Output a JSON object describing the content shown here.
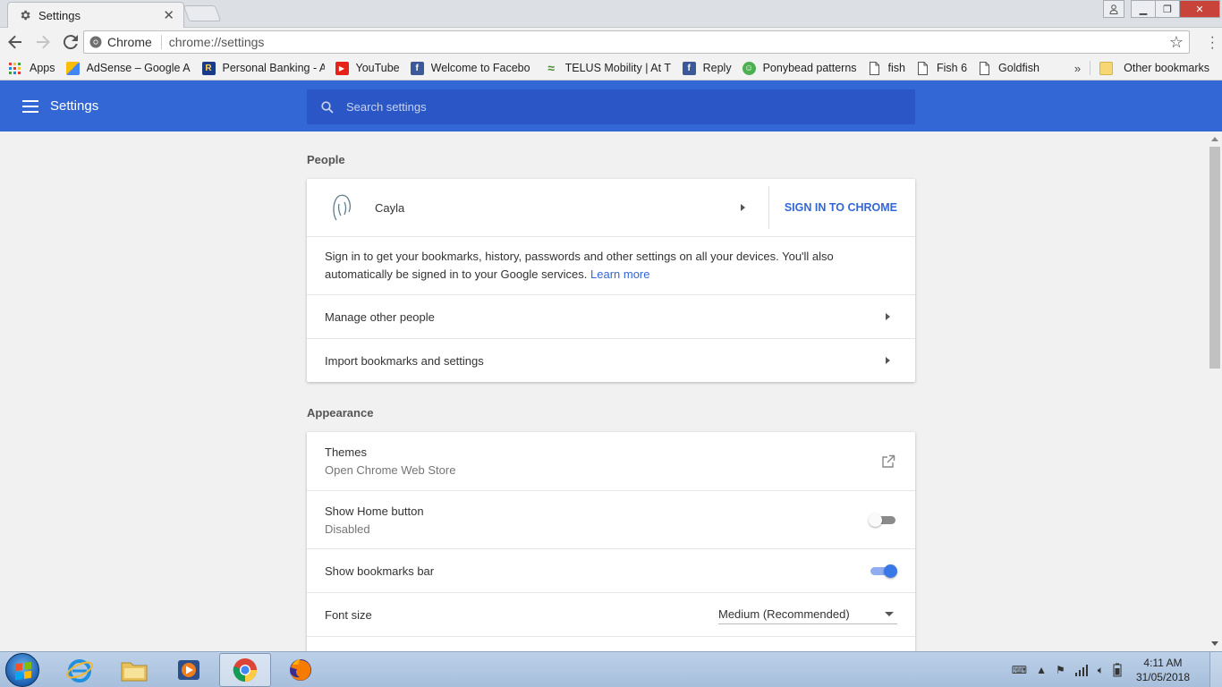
{
  "tab": {
    "title": "Settings"
  },
  "omnibox": {
    "site": "Chrome",
    "url": "chrome://settings"
  },
  "bookmarks": [
    {
      "label": "Apps",
      "icon": "apps-grid-icon"
    },
    {
      "label": "AdSense – Google A",
      "icon": "adsense-icon"
    },
    {
      "label": "Personal Banking - A",
      "icon": "bank-icon"
    },
    {
      "label": "YouTube",
      "icon": "youtube-icon"
    },
    {
      "label": "Welcome to Facebo",
      "icon": "facebook-icon"
    },
    {
      "label": "TELUS Mobility | At T",
      "icon": "telus-icon"
    },
    {
      "label": "Reply",
      "icon": "facebook-icon"
    },
    {
      "label": "Ponybead patterns",
      "icon": "ponybead-icon"
    },
    {
      "label": "fish",
      "icon": "page-icon"
    },
    {
      "label": "Fish 6",
      "icon": "page-icon"
    },
    {
      "label": "Goldfish",
      "icon": "page-icon"
    }
  ],
  "bookmarks_more": "»",
  "other_bookmarks": "Other bookmarks",
  "header": {
    "title": "Settings",
    "search_placeholder": "Search settings"
  },
  "people": {
    "section_title": "People",
    "profile_name": "Cayla",
    "sign_in_label": "SIGN IN TO CHROME",
    "description": "Sign in to get your bookmarks, history, passwords and other settings on all your devices. You'll also automatically be signed in to your Google services.",
    "learn_more": "Learn more",
    "manage_other": "Manage other people",
    "import_label": "Import bookmarks and settings"
  },
  "appearance": {
    "section_title": "Appearance",
    "themes_label": "Themes",
    "themes_sub": "Open Chrome Web Store",
    "home_button_label": "Show Home button",
    "home_button_sub": "Disabled",
    "home_button_on": false,
    "bookmarks_bar_label": "Show bookmarks bar",
    "bookmarks_bar_on": true,
    "font_size_label": "Font size",
    "font_size_value": "Medium (Recommended)"
  },
  "taskbar": {
    "time": "4:11 AM",
    "date": "31/05/2018"
  },
  "colors": {
    "accent": "#3367d6",
    "header_search": "#2a56c6"
  }
}
